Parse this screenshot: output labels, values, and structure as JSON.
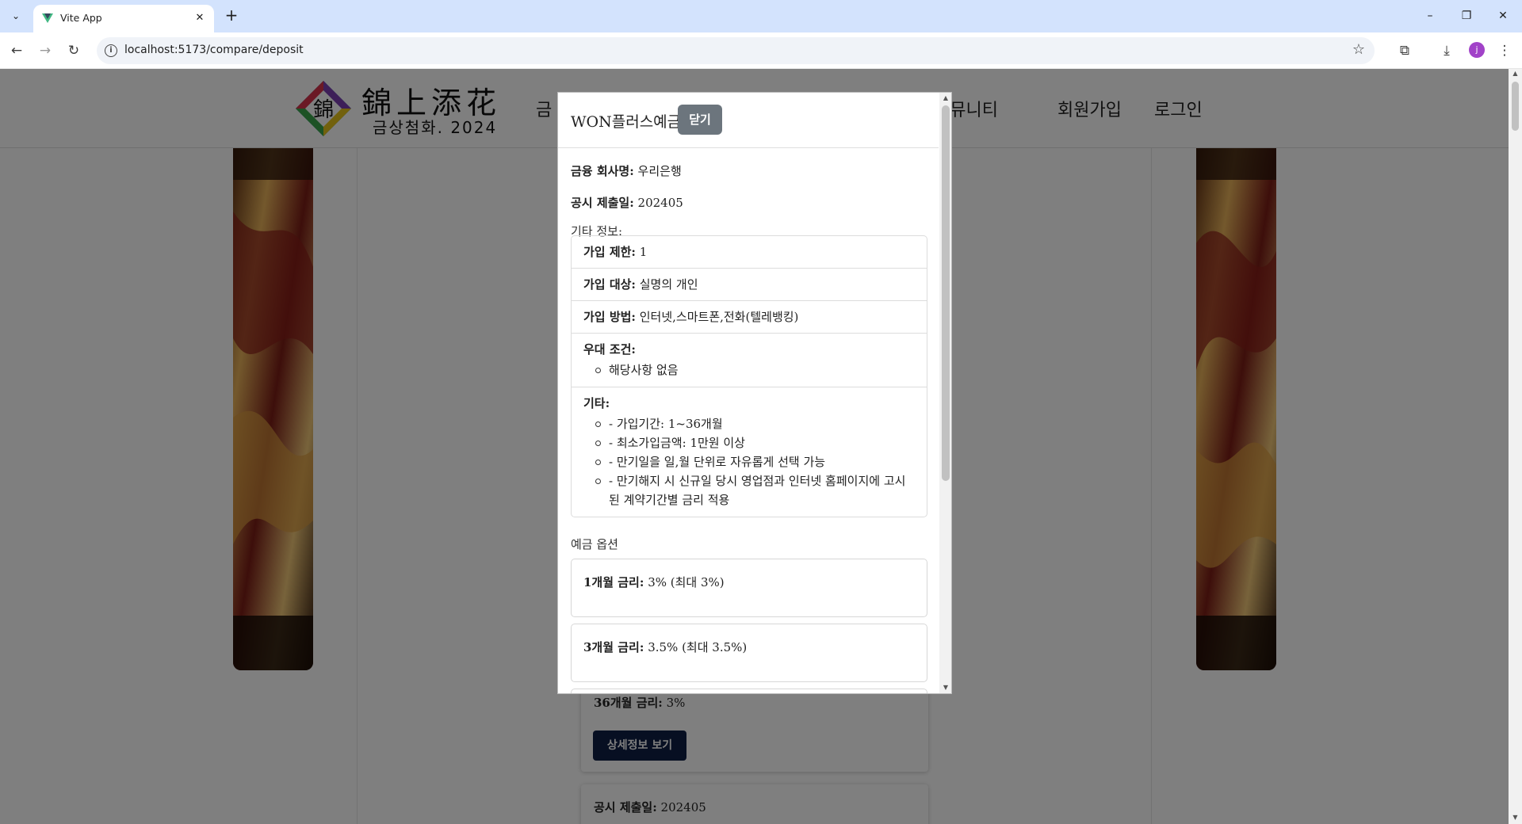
{
  "browser": {
    "tab_title": "Vite App",
    "url": "localhost:5173/compare/deposit",
    "profile_initial": "j"
  },
  "site": {
    "logo_hanja": "錦上添花",
    "logo_mark_char": "錦",
    "logo_subtitle": "금상첨화. 2024",
    "nav": {
      "first_partial": "금",
      "community_partial": "커뮤니티",
      "signup": "회원가입",
      "login": "로그인"
    }
  },
  "background_cards": {
    "card1": {
      "rate_label": "36개월 금리:",
      "rate_value": "3%",
      "button": "상세정보 보기"
    },
    "card2": {
      "date_label": "공시 제출일:",
      "date_value": "202405"
    }
  },
  "modal": {
    "title": "WON플러스예금",
    "close_label": "닫기",
    "company_label": "금융 회사명:",
    "company_value": "우리은행",
    "date_label": "공시 제출일:",
    "date_value": "202405",
    "etc_section": "기타 정보:",
    "info": {
      "limit_label": "가입 제한:",
      "limit_value": "1",
      "target_label": "가입 대상:",
      "target_value": "실명의 개인",
      "method_label": "가입 방법:",
      "method_value": "인터넷,스마트폰,전화(텔레뱅킹)",
      "benefit_label": "우대 조건:",
      "benefits": [
        "해당사항 없음"
      ],
      "other_label": "기타:",
      "others": [
        "- 가입기간: 1~36개월",
        "- 최소가입금액: 1만원 이상",
        "- 만기일을 일,월 단위로 자유롭게 선택 가능",
        "- 만기해지 시 신규일 당시 영업점과 인터넷 홈페이지에 고시된 계약기간별 금리 적용"
      ]
    },
    "options_section": "예금 옵션",
    "options": [
      {
        "label": "1개월 금리:",
        "value": "3% (최대 3%)"
      },
      {
        "label": "3개월 금리:",
        "value": "3.5% (최대 3.5%)"
      }
    ]
  },
  "colors": {
    "chrome_tabstrip": "#d3e3fd",
    "close_button": "#6c757d",
    "detail_button": "#0f1f45",
    "profile": "#a142c8"
  }
}
